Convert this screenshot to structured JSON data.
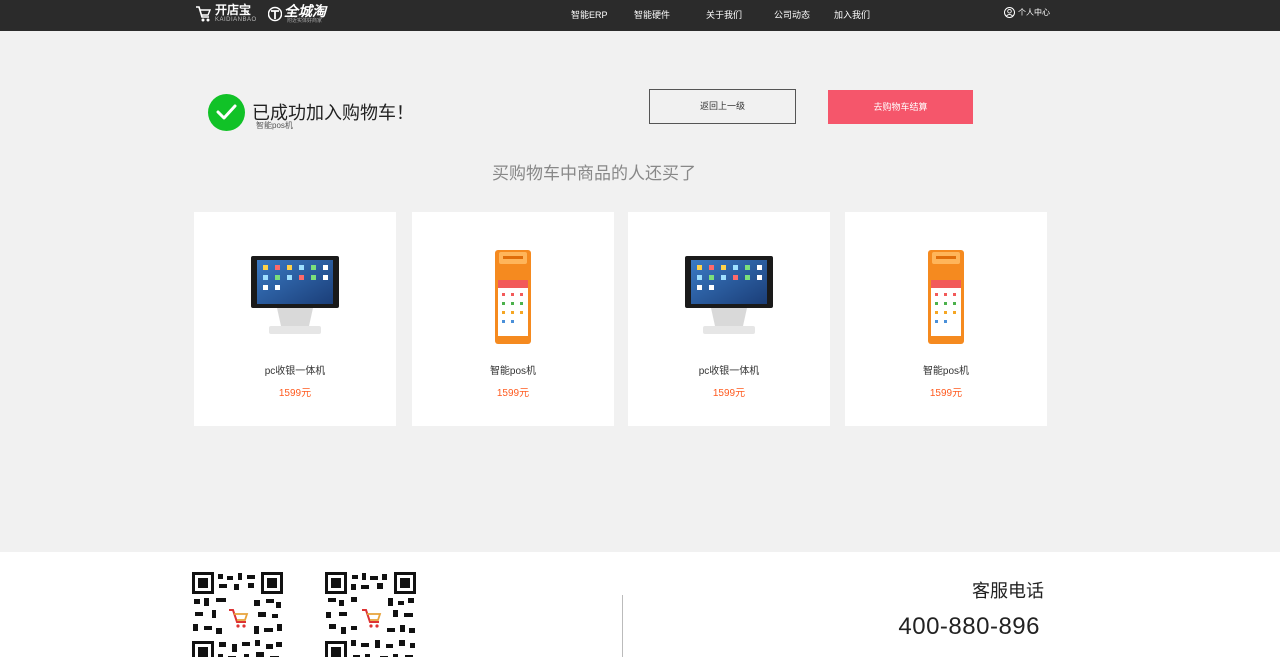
{
  "header": {
    "logo_primary_cn": "开店宝",
    "logo_primary_en": "KAIDIANBAO",
    "logo_secondary_cn": "全城淘",
    "logo_secondary_sub": "附近实体好商家",
    "nav": [
      "智能ERP",
      "智能硬件",
      "关于我们",
      "公司动态",
      "加入我们"
    ],
    "user_center": "个人中心"
  },
  "success": {
    "title": "已成功加入购物车！",
    "product_name": "智能pos机",
    "back_button": "返回上一级",
    "checkout_button": "去购物车结算"
  },
  "recommend": {
    "title": "买购物车中商品的人还买了",
    "products": [
      {
        "name": "pc收银一体机",
        "price": "1599元",
        "image": "pc-terminal-icon"
      },
      {
        "name": "智能pos机",
        "price": "1599元",
        "image": "handheld-pos-icon"
      },
      {
        "name": "pc收银一体机",
        "price": "1599元",
        "image": "pc-terminal-icon"
      },
      {
        "name": "智能pos机",
        "price": "1599元",
        "image": "handheld-pos-icon"
      }
    ]
  },
  "footer": {
    "service_label": "客服电话",
    "service_phone": "400-880-896"
  },
  "colors": {
    "header_bg": "#2b2b2b",
    "success_green": "#11c227",
    "checkout_pink": "#f5566b",
    "price_orange": "#ff5a1f"
  }
}
